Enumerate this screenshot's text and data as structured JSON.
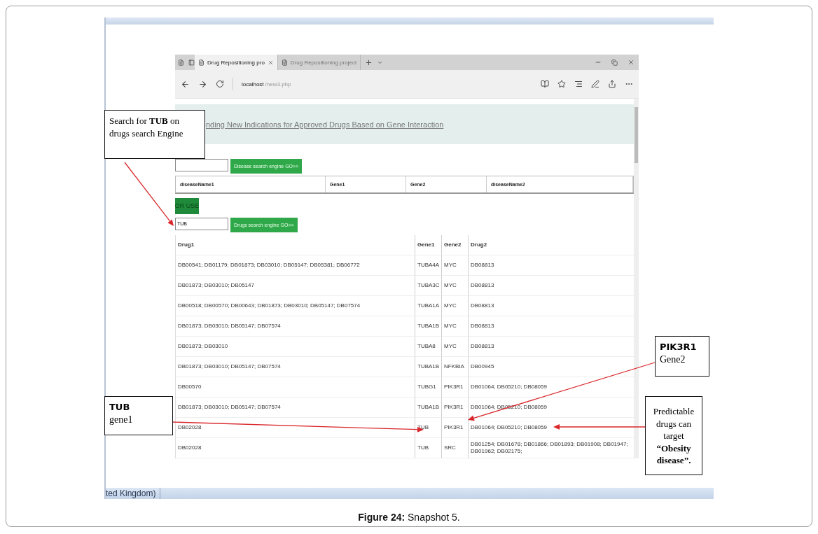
{
  "browser": {
    "tabs": [
      {
        "label": "Drug Repositioning pro",
        "selected": true
      },
      {
        "label": "Drug Repositioning project",
        "selected": false
      }
    ],
    "url_host": "localhost",
    "url_path": "/new3.php"
  },
  "banner_title": "nding New Indications for Approved Drugs Based on Gene Interaction",
  "disease_search": {
    "button": "Disease search engine GO>>",
    "columns": [
      "diseaseName1",
      "Gene1",
      "Gene2",
      "diseaseName2"
    ]
  },
  "or_use": "OR USE",
  "drug_search": {
    "value": "TUB",
    "button": "Drugs search engine GO>>"
  },
  "drug_table": {
    "columns": [
      "Drug1",
      "Gene1",
      "Gene2",
      "Drug2"
    ],
    "rows": [
      [
        "DB00541; DB01179; DB01873; DB03010; DB05147; DB05381; DB06772",
        "TUBA4A",
        "MYC",
        "DB08813"
      ],
      [
        "DB01873; DB03010; DB05147",
        "TUBA3C",
        "MYC",
        "DB08813"
      ],
      [
        "DB00518; DB00570; DB00643; DB01873; DB03010; DB05147; DB07574",
        "TUBA1A",
        "MYC",
        "DB08813"
      ],
      [
        "DB01873; DB03010; DB05147; DB07574",
        "TUBA1B",
        "MYC",
        "DB08813"
      ],
      [
        "DB01873; DB03010",
        "TUBA8",
        "MYC",
        "DB08813"
      ],
      [
        "DB01873; DB03010; DB05147; DB07574",
        "TUBA1B",
        "NFKBIA",
        "DB00945"
      ],
      [
        "DB00570",
        "TUBG1",
        "PIK3R1",
        "DB01064; DB05210; DB08059"
      ],
      [
        "DB01873; DB03010; DB05147; DB07574",
        "TUBA1B",
        "PIK3R1",
        "DB01064; DB05210; DB08059"
      ],
      [
        "DB02028",
        "TUB",
        "PIK3R1",
        "DB01064; DB05210; DB08059"
      ],
      [
        "DB02028",
        "TUB",
        "SRC",
        "DB01254; DB01678; DB01866; DB01893; DB01908; DB01947; DB01962; DB02175;"
      ]
    ]
  },
  "status_text": "ted Kingdom)",
  "annotations": [
    {
      "text": "Search for **TUB** on drugs search Engine"
    },
    {
      "title": "PIK3R1",
      "text": "Gene2"
    },
    {
      "title": "TUB",
      "text": "gene1"
    },
    {
      "text": "Predictable drugs can target **“Obesity disease”.**"
    }
  ],
  "caption": "**Figure 24:** Snapshot 5."
}
